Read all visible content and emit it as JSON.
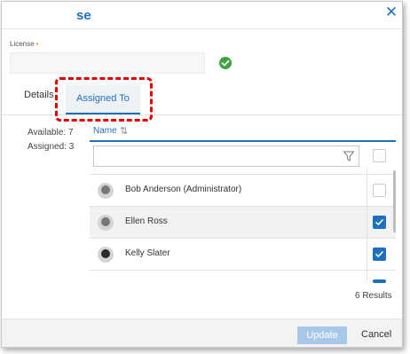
{
  "dialog": {
    "title": "se"
  },
  "license": {
    "label": "License",
    "required_marker": "•",
    "value": ""
  },
  "tabs": [
    {
      "label": "Details"
    },
    {
      "label": "Assigned To"
    }
  ],
  "stats": {
    "available": "Available: 7",
    "assigned": "Assigned: 3"
  },
  "grid": {
    "column_name": "Name",
    "sort_icon": "⇅",
    "filter_placeholder": "",
    "rows": [
      {
        "name": "Bob Anderson (Administrator)",
        "checked": false
      },
      {
        "name": "Ellen Ross",
        "checked": true
      },
      {
        "name": "Kelly Slater",
        "checked": true
      }
    ],
    "results": "6 Results"
  },
  "footer": {
    "update_label": "Update",
    "cancel_label": "Cancel"
  },
  "colors": {
    "accent": "#1f6fbf",
    "highlight": "#e00000",
    "success": "#3fa33f"
  },
  "icons": {
    "close": "close-icon",
    "check": "check-circle-icon",
    "filter": "filter-icon",
    "sort": "sort-icon"
  }
}
